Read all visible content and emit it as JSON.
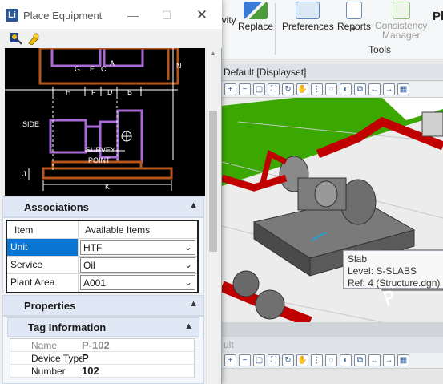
{
  "ribbon": {
    "partial_label": "ivity",
    "replace_label": "Replace",
    "preferences_label": "Preferences",
    "reports_label": "Reports",
    "consistency_line1": "Consistency",
    "consistency_line2": "Manager",
    "plant_label": "Pl",
    "group_label": "Tools"
  },
  "view1": {
    "title": "Default [Displayset]"
  },
  "view2": {
    "title": "ult"
  },
  "tooltip": {
    "name": "Slab",
    "level": "Level: S-SLABS",
    "ref": "Ref: 4 (Structure.dgn)"
  },
  "dialog": {
    "title": "Place Equipment",
    "app_icon_letter": "Li",
    "drawing_labels": {
      "g": "G",
      "e": "E",
      "c": "C",
      "a": "A",
      "n": "N",
      "h": "H",
      "f": "F",
      "d": "D",
      "b": "B",
      "side": "SIDE",
      "survey": "SURVEY",
      "point": "POINT",
      "j": "J",
      "k": "K"
    },
    "associations": {
      "title": "Associations",
      "col_item": "Item",
      "col_available": "Available Items",
      "rows": [
        {
          "item": "Unit",
          "value": "HTF"
        },
        {
          "item": "Service",
          "value": "Oil"
        },
        {
          "item": "Plant Area",
          "value": "A001"
        }
      ]
    },
    "properties": {
      "title": "Properties",
      "tag_information": {
        "title": "Tag Information",
        "rows": [
          {
            "label": "Name",
            "value": "P-102"
          },
          {
            "label": "Device Type Co",
            "value": "P"
          },
          {
            "label": "Number",
            "value": "102"
          }
        ]
      }
    }
  },
  "colors": {
    "selection": "#0a76d4",
    "section_header": "#dfe8f4",
    "pipe": "#d10000",
    "ground": "#3aa800",
    "drawing_purple": "#a86bd6",
    "drawing_brown": "#b5561c"
  }
}
